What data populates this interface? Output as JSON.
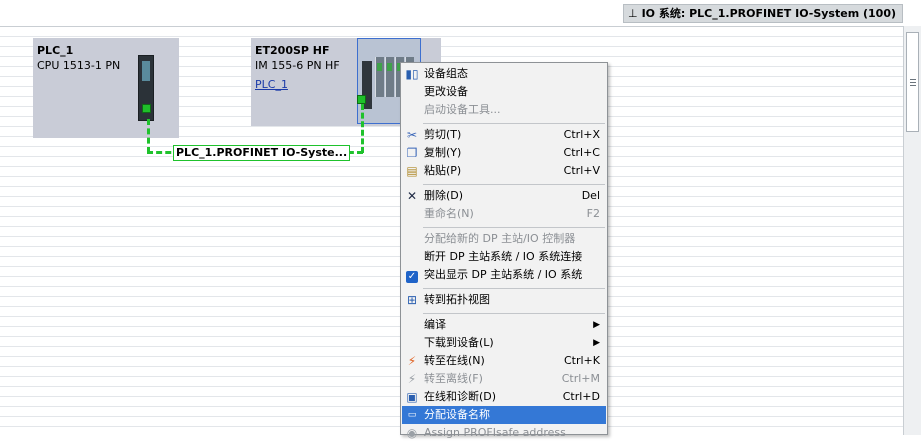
{
  "header": {
    "io_system_label": "IO 系统: PLC_1.PROFINET IO-System (100)"
  },
  "devices": {
    "plc": {
      "name": "PLC_1",
      "type": "CPU 1513-1 PN"
    },
    "et200": {
      "name": "ET200SP HF",
      "type": "IM 155-6 PN HF",
      "link": "PLC_1"
    }
  },
  "network": {
    "label": "PLC_1.PROFINET IO-Syste..."
  },
  "context_menu": {
    "items": [
      {
        "label": "设备组态",
        "shortcut": "",
        "disabled": false,
        "icon": "device-configuration-icon"
      },
      {
        "label": "更改设备",
        "shortcut": "",
        "disabled": false,
        "icon": ""
      },
      {
        "label": "启动设备工具...",
        "shortcut": "",
        "disabled": true,
        "icon": ""
      },
      {
        "label": "剪切(T)",
        "shortcut": "Ctrl+X",
        "disabled": false,
        "icon": "scissors-icon"
      },
      {
        "label": "复制(Y)",
        "shortcut": "Ctrl+C",
        "disabled": false,
        "icon": "copy-icon"
      },
      {
        "label": "粘贴(P)",
        "shortcut": "Ctrl+V",
        "disabled": false,
        "icon": "paste-icon"
      },
      {
        "label": "删除(D)",
        "shortcut": "Del",
        "disabled": false,
        "icon": "delete-x-icon"
      },
      {
        "label": "重命名(N)",
        "shortcut": "F2",
        "disabled": true,
        "icon": ""
      },
      {
        "label": "分配给新的 DP 主站/IO 控制器",
        "shortcut": "",
        "disabled": true,
        "icon": ""
      },
      {
        "label": "断开 DP 主站系统 / IO 系统连接",
        "shortcut": "",
        "disabled": false,
        "icon": ""
      },
      {
        "label": "突出显示 DP 主站系统 / IO 系统",
        "shortcut": "",
        "disabled": false,
        "icon": "checkbox-checked-icon"
      },
      {
        "label": "转到拓扑视图",
        "shortcut": "",
        "disabled": false,
        "icon": "topology-icon"
      },
      {
        "label": "编译",
        "shortcut": "",
        "disabled": false,
        "icon": "",
        "submenu": true
      },
      {
        "label": "下载到设备(L)",
        "shortcut": "",
        "disabled": false,
        "icon": "",
        "submenu": true
      },
      {
        "label": "转至在线(N)",
        "shortcut": "Ctrl+K",
        "disabled": false,
        "icon": "go-online-icon"
      },
      {
        "label": "转至离线(F)",
        "shortcut": "Ctrl+M",
        "disabled": true,
        "icon": "go-offline-icon"
      },
      {
        "label": "在线和诊断(D)",
        "shortcut": "Ctrl+D",
        "disabled": false,
        "icon": "diagnostics-icon"
      },
      {
        "label": "分配设备名称",
        "shortcut": "",
        "disabled": false,
        "icon": "assign-name-icon",
        "selected": true
      },
      {
        "label": "Assign PROFIsafe address",
        "shortcut": "",
        "disabled": true,
        "icon": "profisafe-icon"
      }
    ]
  }
}
